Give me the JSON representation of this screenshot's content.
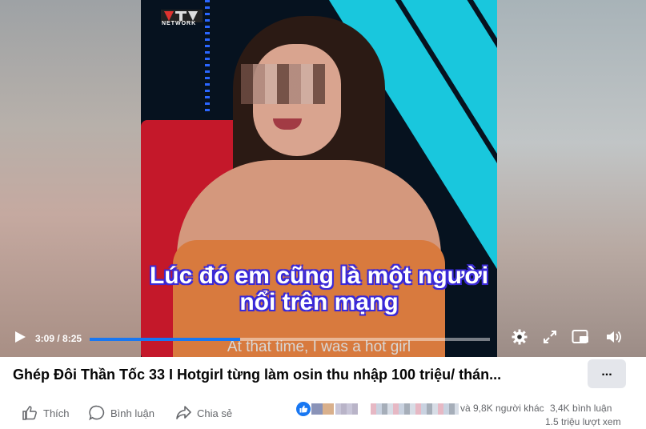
{
  "video": {
    "logo_text": "NETWORK",
    "caption_line1": "Lúc đó em cũng là một người",
    "caption_line2": "nổi trên mạng",
    "subtitle": "At that time, I was a hot girl",
    "time": "3:09 / 8:25",
    "progress": 0.375,
    "icons": [
      "play-icon",
      "settings-icon",
      "fullscreen-icon",
      "pip-icon",
      "volume-icon"
    ]
  },
  "post": {
    "title": "Ghép Đôi Thần Tốc 33 I Hotgirl từng làm osin thu nhập 100 triệu/ thán...",
    "more": "...",
    "actions": {
      "like": "Thích",
      "comment": "Bình luận",
      "share": "Chia sẻ"
    },
    "reactions_text": "và 9,8K người khác",
    "comments_count": "3,4K bình luận",
    "views": "1.5 triệu lượt xem"
  },
  "colors": {
    "accent": "#1877f2",
    "stripe": "#19c7dd",
    "caption_outline": "#3a2ad8"
  }
}
